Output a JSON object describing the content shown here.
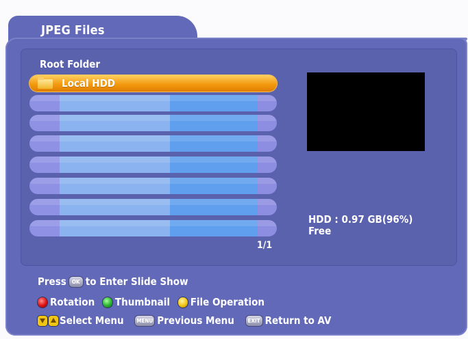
{
  "header": {
    "title": "JPEG Files"
  },
  "browser": {
    "folder_label": "Root Folder",
    "items": [
      {
        "label": "Local HDD",
        "selected": true,
        "icon": "folder-icon"
      },
      {
        "label": ""
      },
      {
        "label": ""
      },
      {
        "label": ""
      },
      {
        "label": ""
      },
      {
        "label": ""
      },
      {
        "label": ""
      },
      {
        "label": ""
      }
    ],
    "page": "1/1"
  },
  "info": {
    "hdd_line1": "HDD : 0.97 GB(96%)",
    "hdd_line2": "Free"
  },
  "help": {
    "press": "Press",
    "ok": "OK",
    "enter_slide": "to Enter Slide Show",
    "rotation": "Rotation",
    "thumbnail": "Thumbnail",
    "file_operation": "File Operation",
    "select_menu": "Select Menu",
    "menu_key": "MENU",
    "previous_menu": "Previous Menu",
    "exit_key": "EXIT",
    "return_av": "Return to AV"
  },
  "colors": {
    "panel": "#6269b8",
    "selection": "#f39a10",
    "preview": "#000000"
  }
}
